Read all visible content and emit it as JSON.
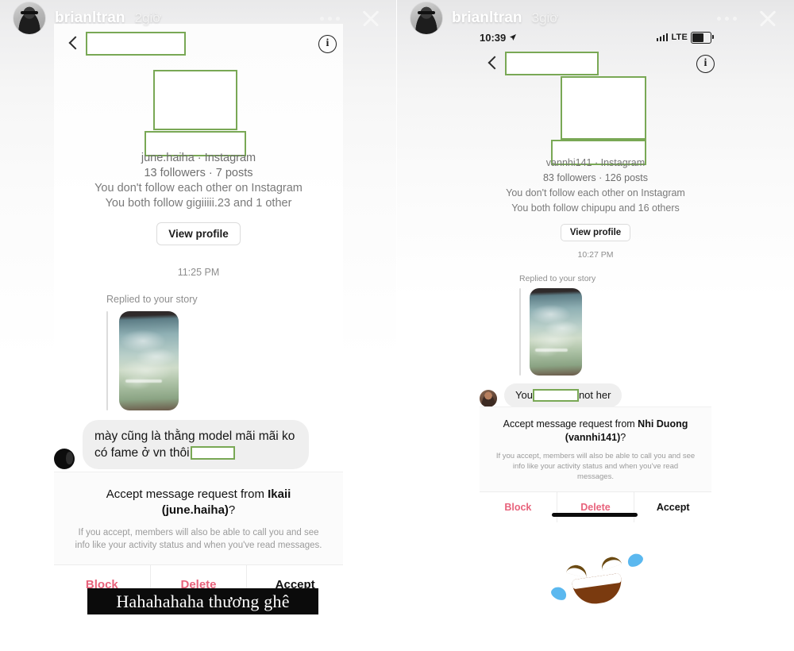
{
  "meta": {
    "accent_green": "#79a855",
    "danger": "#e8637c",
    "bubble_bg": "#efefef"
  },
  "panels": [
    {
      "id": "left",
      "story": {
        "username": "brianltran",
        "timestamp": "2giờ",
        "avatar_label": "brianltran-avatar",
        "more_label": "More options",
        "close_label": "Close story"
      },
      "nav": {
        "back_label": "Back",
        "name_redacted": true,
        "info_label": "Details"
      },
      "profile": {
        "handle": "june.haiha · Instagram",
        "stats": "13 followers · 7 posts",
        "relation_1": "You don't follow each other on Instagram",
        "relation_2": "You both follow gigiiiii.23 and 1 other",
        "view_profile": "View profile"
      },
      "conversation": {
        "time": "11:25 PM",
        "replied_label": "Replied to your story",
        "bubble_text_before": "mày cũng là thằng model mãi mãi ko có fame ở vn thôi",
        "bubble_redacted": true
      },
      "request": {
        "title_prefix": "Accept message request from ",
        "title_name": "Ikaii (june.haiha)",
        "title_suffix": "?",
        "subtitle": "If you accept, members will also be able to call you and see info like your activity status and when you've read messages.",
        "block": "Block",
        "delete": "Delete",
        "accept": "Accept"
      },
      "caption": "Hahahahaha thương ghê"
    },
    {
      "id": "right",
      "story": {
        "username": "brianltran",
        "timestamp": "3giờ",
        "avatar_label": "brianltran-avatar",
        "more_label": "More options",
        "close_label": "Close story"
      },
      "statusbar": {
        "time": "10:39",
        "carrier": "LTE"
      },
      "nav": {
        "back_label": "Back",
        "name_redacted": true,
        "info_label": "Details"
      },
      "profile": {
        "handle": "vannhi141 · Instagram",
        "stats": "83 followers · 126 posts",
        "relation_1": "You don't follow each other on Instagram",
        "relation_2": "You both follow chipupu and 16 others",
        "view_profile": "View profile"
      },
      "conversation": {
        "time": "10:27 PM",
        "replied_label": "Replied to your story",
        "bubble_text_before": "You",
        "bubble_text_after": "not her",
        "bubble_redacted": true
      },
      "request": {
        "title_prefix": "Accept message request from ",
        "title_name": "Nhi Duong (vannhi141)",
        "title_suffix": "?",
        "subtitle": "If you accept, members will also be able to call you and see info like your activity status and when you've read messages.",
        "block": "Block",
        "delete": "Delete",
        "accept": "Accept"
      },
      "reaction_emoji": "🤣"
    }
  ]
}
